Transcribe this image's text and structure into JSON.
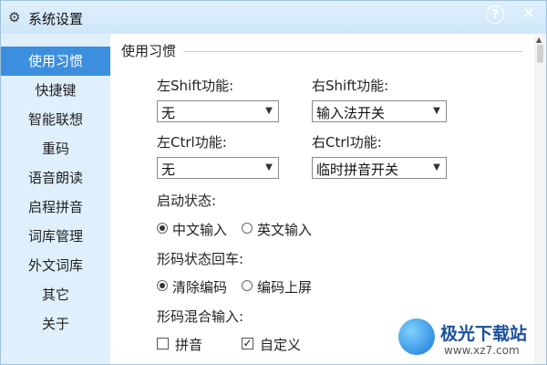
{
  "window": {
    "title": "系统设置",
    "help_label": "?",
    "close_label": "✕"
  },
  "sidebar": {
    "items": [
      {
        "label": "使用习惯",
        "active": true
      },
      {
        "label": "快捷键"
      },
      {
        "label": "智能联想"
      },
      {
        "label": "重码"
      },
      {
        "label": "语音朗读"
      },
      {
        "label": "启程拼音"
      },
      {
        "label": "词库管理"
      },
      {
        "label": "外文词库"
      },
      {
        "label": "其它"
      },
      {
        "label": "关于"
      }
    ]
  },
  "main": {
    "section_title": "使用习惯",
    "left_shift": {
      "label": "左Shift功能:",
      "value": "无"
    },
    "right_shift": {
      "label": "右Shift功能:",
      "value": "输入法开关"
    },
    "left_ctrl": {
      "label": "左Ctrl功能:",
      "value": "无"
    },
    "right_ctrl": {
      "label": "右Ctrl功能:",
      "value": "临时拼音开关"
    },
    "startup": {
      "label": "启动状态:",
      "options": [
        "中文输入",
        "英文输入"
      ],
      "selected": 0
    },
    "shape_enter": {
      "label": "形码状态回车:",
      "options": [
        "清除编码",
        "编码上屏"
      ],
      "selected": 0
    },
    "mixed_input": {
      "label": "形码混合输入:",
      "options": [
        {
          "label": "拼音",
          "checked": false
        },
        {
          "label": "自定义",
          "checked": true
        }
      ]
    }
  },
  "watermark": {
    "title": "极光下载站",
    "url": "www.xz7.com"
  },
  "icons": {
    "title": "gear-icon",
    "dropdown": "chevron-down-icon"
  }
}
